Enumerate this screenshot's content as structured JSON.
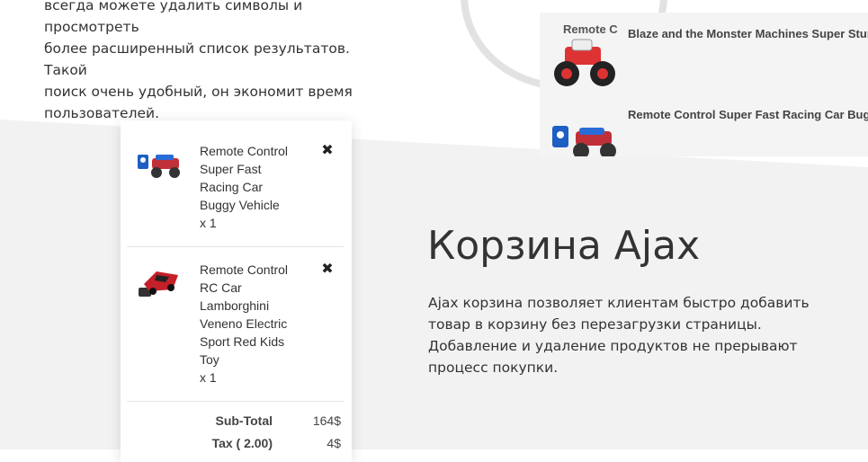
{
  "intro": {
    "lines": [
      "всегда можете удалить символы и просмотреть",
      "более расширенный список результатов. Такой",
      "поиск очень удобный, он экономит время",
      "пользователей."
    ]
  },
  "search_results": {
    "overlay_label": "Remote C",
    "items": [
      {
        "title": "Blaze and the Monster Machines Super Stunts",
        "icon": "monster-truck-image"
      },
      {
        "title": "Remote Control Super Fast Racing Car Buggy Vehicle",
        "icon": "buggy-car-image"
      }
    ]
  },
  "cart": {
    "items": [
      {
        "name": "Remote Control Super Fast Racing Car Buggy Vehicle",
        "qty": "x 1",
        "icon": "buggy-car-image"
      },
      {
        "name": "Remote Control RC Car Lamborghini Veneno Electric Sport Red Kids Toy",
        "qty": "x 1",
        "icon": "red-sports-car-image"
      }
    ],
    "remove_symbol": "✖",
    "subtotal_label": "Sub-Total",
    "subtotal_value": "164$",
    "tax_label": "Tax ( 2.00)",
    "tax_value": "4$"
  },
  "section": {
    "title": "Корзина Ajax",
    "description": "Ajax корзина позволяет клиентам быстро добавить товар в корзину без перезагрузки страницы. Добавление и удаление продуктов не прерывают процесс покупки."
  },
  "colors": {
    "background": "#ffffff",
    "band": "#f2f2f2",
    "text": "#333333"
  }
}
